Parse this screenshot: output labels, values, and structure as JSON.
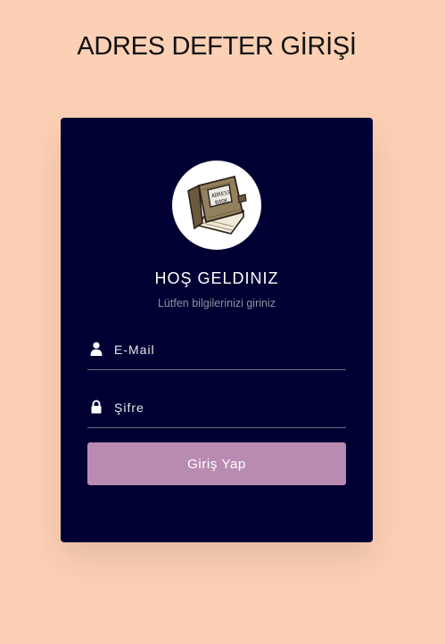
{
  "page": {
    "title": "ADRES DEFTER GİRİŞİ",
    "background_color": "#fcd0b4"
  },
  "card": {
    "background_color": "#000033",
    "logo_icon": "address-book-icon",
    "logo_text_line1": "ADRESS",
    "logo_text_line2": "BOOK",
    "welcome": "HOŞ GELDINIZ",
    "subtitle": "Lütfen bilgilerinizi giriniz"
  },
  "form": {
    "email": {
      "icon": "user-icon",
      "placeholder": "E-Mail",
      "value": ""
    },
    "password": {
      "icon": "lock-icon",
      "placeholder": "Şifre",
      "value": ""
    },
    "submit_label": "Giriş Yap",
    "submit_color": "#b98bb2"
  }
}
